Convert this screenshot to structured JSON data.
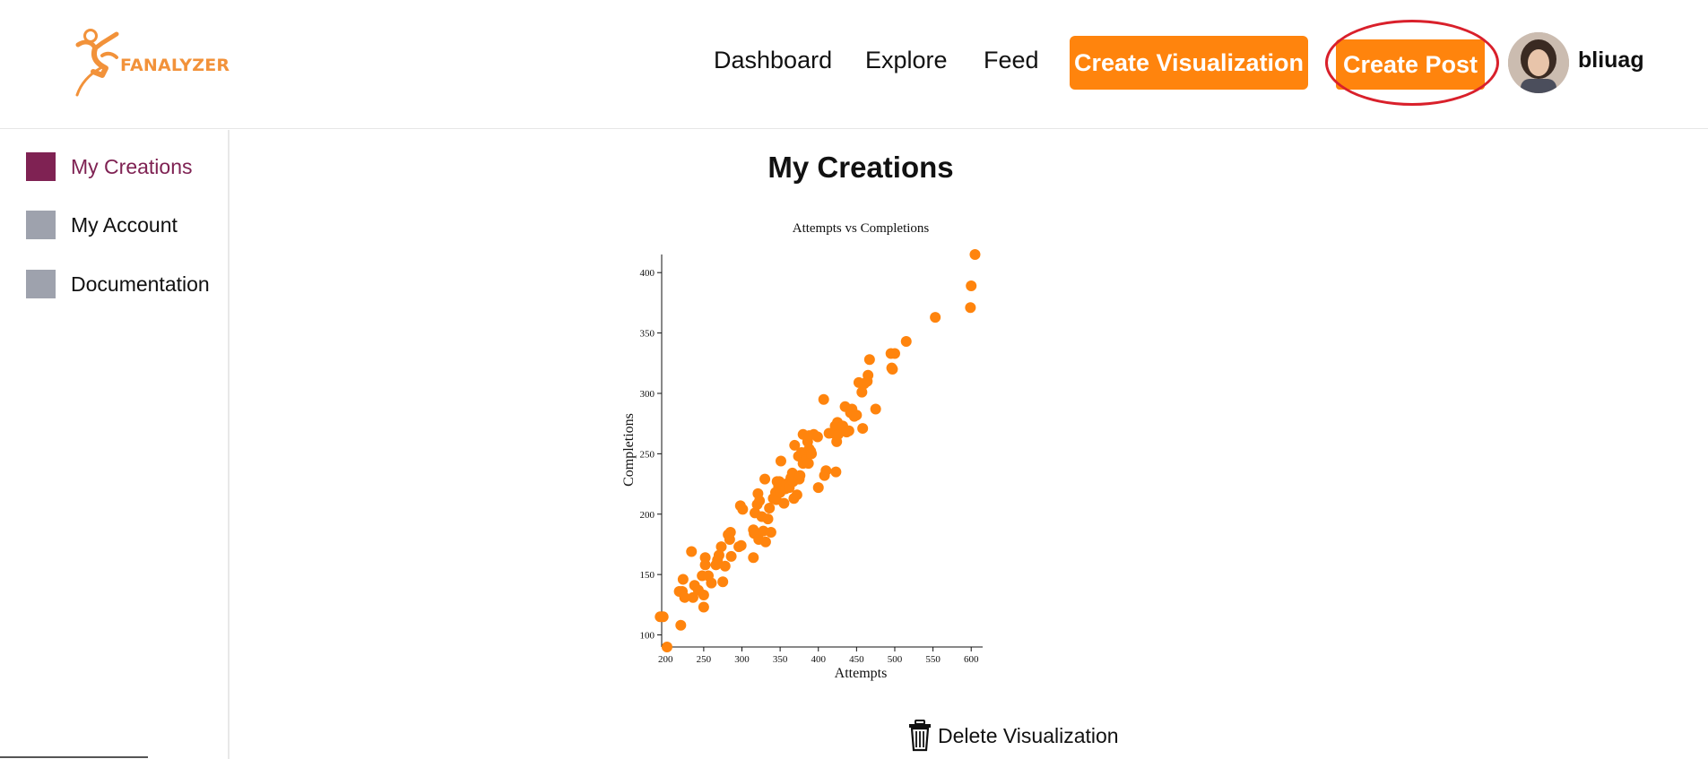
{
  "header": {
    "logo_text": "FANALYZER",
    "nav": {
      "dashboard": "Dashboard",
      "explore": "Explore",
      "feed": "Feed"
    },
    "create_visualization_label": "Create Visualization",
    "create_post_label": "Create Post",
    "username": "bliuag",
    "accent_color": "#ff840d"
  },
  "sidebar": {
    "items": [
      {
        "label": "My Creations",
        "active": true,
        "color": "#7f2253"
      },
      {
        "label": "My Account",
        "active": false,
        "color": "#9ea2ad"
      },
      {
        "label": "Documentation",
        "active": false,
        "color": "#9ea2ad"
      }
    ]
  },
  "main": {
    "title": "My Creations",
    "delete_label": "Delete Visualization"
  },
  "chart_data": {
    "type": "scatter",
    "title": "Attempts vs Completions",
    "xlabel": "Attempts",
    "ylabel": "Completions",
    "xlim": [
      195,
      615
    ],
    "ylim": [
      90,
      415
    ],
    "xticks": [
      200,
      250,
      300,
      350,
      400,
      450,
      500,
      550,
      600
    ],
    "yticks": [
      100,
      150,
      200,
      250,
      300,
      350,
      400
    ],
    "marker_color": "#ff840d",
    "points": [
      [
        193,
        115
      ],
      [
        197,
        115
      ],
      [
        202,
        90
      ],
      [
        218,
        136
      ],
      [
        220,
        108
      ],
      [
        222,
        136
      ],
      [
        223,
        146
      ],
      [
        225,
        131
      ],
      [
        234,
        169
      ],
      [
        236,
        131
      ],
      [
        238,
        141
      ],
      [
        243,
        137
      ],
      [
        248,
        149
      ],
      [
        250,
        123
      ],
      [
        250,
        133
      ],
      [
        252,
        158
      ],
      [
        252,
        164
      ],
      [
        256,
        149
      ],
      [
        260,
        143
      ],
      [
        266,
        158
      ],
      [
        268,
        162
      ],
      [
        270,
        166
      ],
      [
        273,
        173
      ],
      [
        275,
        144
      ],
      [
        278,
        157
      ],
      [
        282,
        183
      ],
      [
        284,
        179
      ],
      [
        285,
        185
      ],
      [
        286,
        165
      ],
      [
        296,
        173
      ],
      [
        298,
        207
      ],
      [
        299,
        174
      ],
      [
        301,
        204
      ],
      [
        315,
        187
      ],
      [
        315,
        164
      ],
      [
        316,
        184
      ],
      [
        317,
        201
      ],
      [
        320,
        208
      ],
      [
        321,
        217
      ],
      [
        322,
        179
      ],
      [
        323,
        211
      ],
      [
        326,
        198
      ],
      [
        328,
        186
      ],
      [
        330,
        229
      ],
      [
        331,
        177
      ],
      [
        334,
        196
      ],
      [
        336,
        205
      ],
      [
        338,
        185
      ],
      [
        341,
        213
      ],
      [
        344,
        218
      ],
      [
        345,
        212
      ],
      [
        346,
        227
      ],
      [
        348,
        223
      ],
      [
        349,
        227
      ],
      [
        350,
        218
      ],
      [
        351,
        244
      ],
      [
        352,
        224
      ],
      [
        355,
        209
      ],
      [
        357,
        221
      ],
      [
        358,
        225
      ],
      [
        362,
        222
      ],
      [
        364,
        230
      ],
      [
        366,
        234
      ],
      [
        367,
        227
      ],
      [
        368,
        213
      ],
      [
        369,
        257
      ],
      [
        372,
        216
      ],
      [
        374,
        248
      ],
      [
        375,
        229
      ],
      [
        376,
        232
      ],
      [
        378,
        251
      ],
      [
        380,
        242
      ],
      [
        380,
        266
      ],
      [
        383,
        251
      ],
      [
        384,
        245
      ],
      [
        386,
        260
      ],
      [
        387,
        242
      ],
      [
        388,
        254
      ],
      [
        388,
        265
      ],
      [
        390,
        252
      ],
      [
        391,
        250
      ],
      [
        394,
        266
      ],
      [
        399,
        264
      ],
      [
        400,
        222
      ],
      [
        407,
        295
      ],
      [
        408,
        232
      ],
      [
        410,
        236
      ],
      [
        414,
        267
      ],
      [
        420,
        267
      ],
      [
        422,
        273
      ],
      [
        423,
        235
      ],
      [
        424,
        260
      ],
      [
        425,
        276
      ],
      [
        426,
        266
      ],
      [
        432,
        273
      ],
      [
        435,
        289
      ],
      [
        437,
        268
      ],
      [
        440,
        269
      ],
      [
        442,
        284
      ],
      [
        444,
        287
      ],
      [
        447,
        281
      ],
      [
        450,
        282
      ],
      [
        453,
        309
      ],
      [
        457,
        301
      ],
      [
        458,
        271
      ],
      [
        460,
        308
      ],
      [
        464,
        310
      ],
      [
        465,
        315
      ],
      [
        467,
        328
      ],
      [
        475,
        287
      ],
      [
        495,
        333
      ],
      [
        496,
        321
      ],
      [
        497,
        320
      ],
      [
        500,
        333
      ],
      [
        515,
        343
      ],
      [
        553,
        363
      ],
      [
        599,
        371
      ],
      [
        600,
        389
      ],
      [
        605,
        415
      ]
    ]
  }
}
